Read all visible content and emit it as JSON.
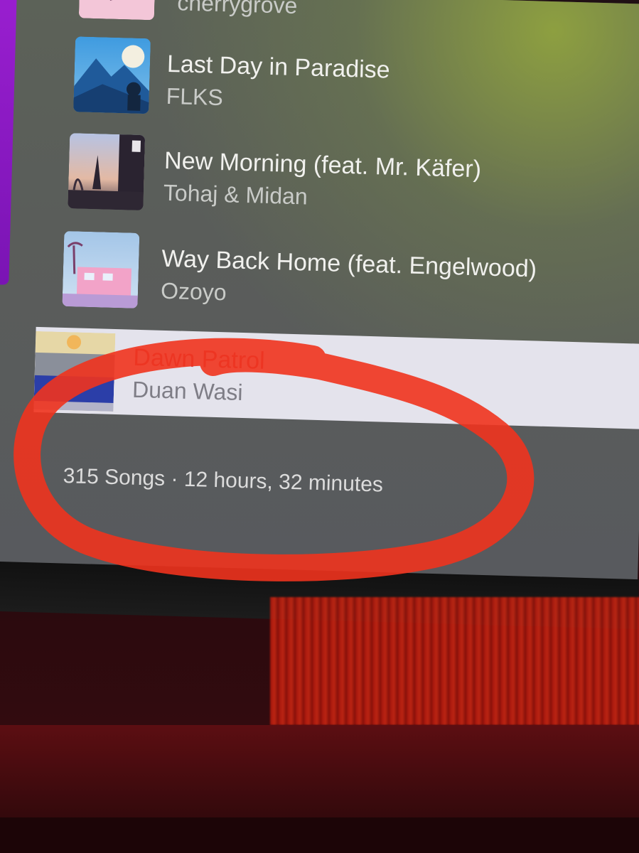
{
  "songs": [
    {
      "title": "",
      "artist": "cherrygrove"
    },
    {
      "title": "Last Day in Paradise",
      "artist": "FLKS"
    },
    {
      "title": "New Morning (feat. Mr. Käfer)",
      "artist": "Tohaj & Midan"
    },
    {
      "title": "Way Back Home (feat. Engelwood)",
      "artist": "Ozoyo"
    },
    {
      "title": "Dawn Patrol",
      "artist": "Duan Wasi"
    }
  ],
  "summary": "315 Songs · 12 hours, 32 minutes",
  "colors": {
    "selected_title": "#d6474a",
    "annotation": "#f0331e",
    "purple_tab": "#9a1fd0"
  }
}
